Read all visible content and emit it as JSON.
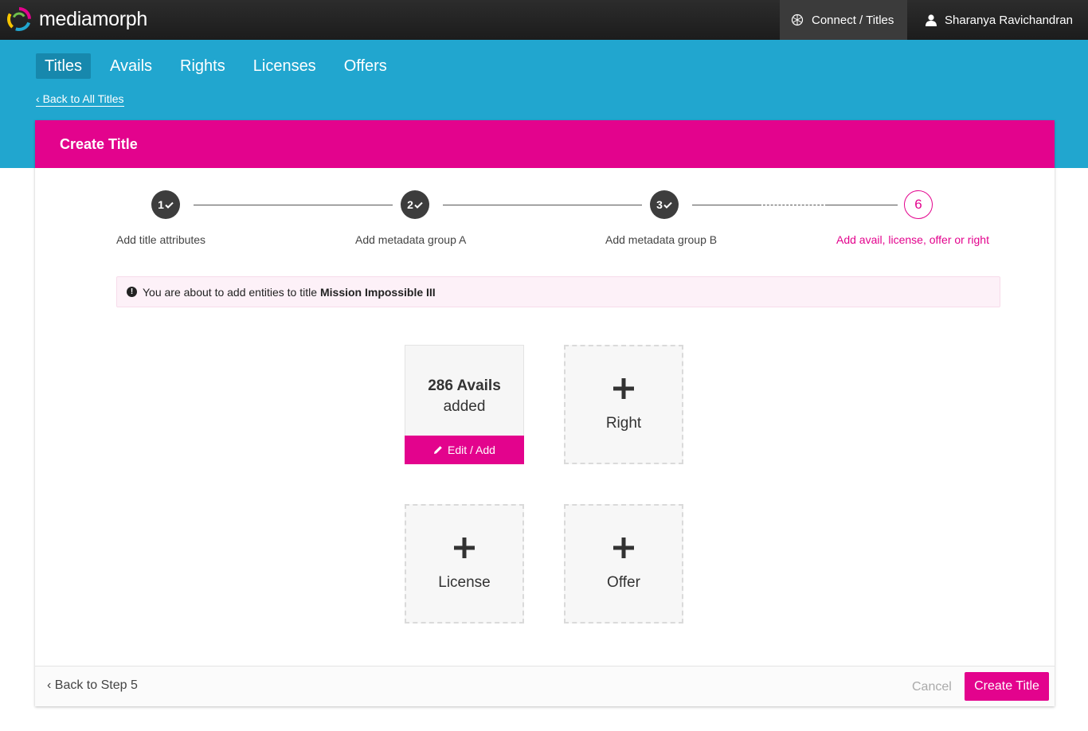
{
  "app": {
    "logo_text": "mediamorph",
    "connect_label": "Connect / Titles",
    "user_name": "Sharanya Ravichandran"
  },
  "nav": {
    "items": [
      {
        "label": "Titles",
        "active": true
      },
      {
        "label": "Avails"
      },
      {
        "label": "Rights"
      },
      {
        "label": "Licenses"
      },
      {
        "label": "Offers"
      }
    ],
    "back_link": "Back to All Titles"
  },
  "card": {
    "title": "Create Title"
  },
  "stepper": {
    "steps": [
      {
        "number": "1",
        "label": "Add title attributes",
        "done": true
      },
      {
        "number": "2",
        "label": "Add metadata group A",
        "done": true
      },
      {
        "number": "3",
        "label": "Add metadata group B",
        "done": true
      },
      {
        "number": "6",
        "label": "Add avail, license, offer or right",
        "current": true
      }
    ]
  },
  "info": {
    "text": "You are about to add entities to title",
    "title_name": "Mission Impossible III"
  },
  "tiles": {
    "avails": {
      "count": "286 Avails",
      "suffix": "added",
      "edit_label": "Edit / Add"
    },
    "right": {
      "label": "Right"
    },
    "license": {
      "label": "License"
    },
    "offer": {
      "label": "Offer"
    }
  },
  "footer": {
    "back_label": "Back to Step 5",
    "cancel_label": "Cancel",
    "create_label": "Create Title"
  },
  "colors": {
    "accent": "#e3038d",
    "blue": "#21a6cf",
    "dark": "#1c1c1c"
  }
}
